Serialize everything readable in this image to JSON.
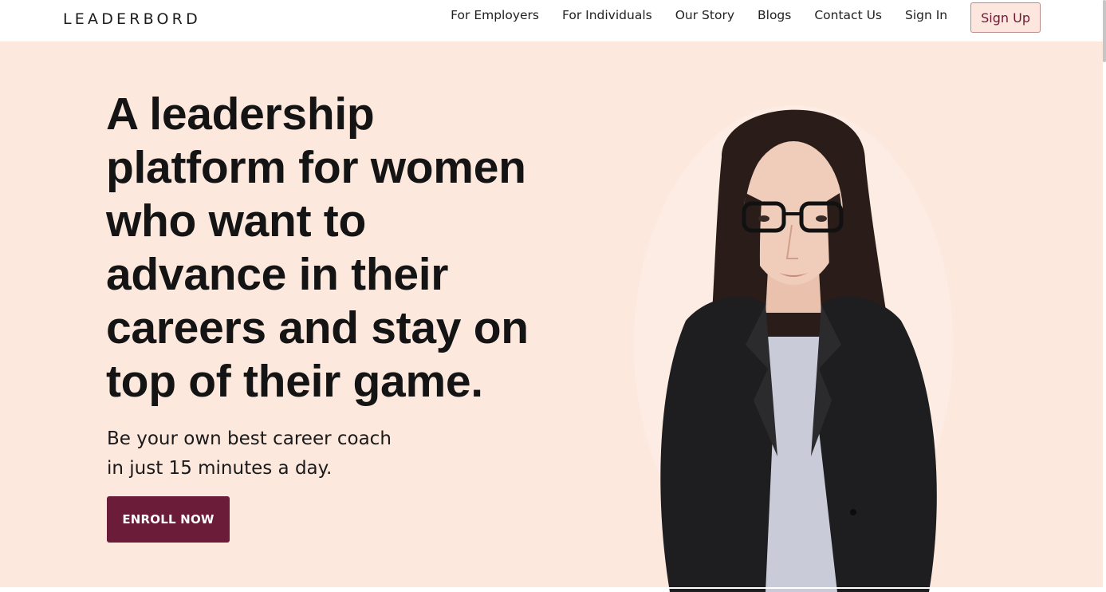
{
  "header": {
    "logo_text": "LEADERBORD",
    "nav": [
      {
        "label": "For Employers"
      },
      {
        "label": "For Individuals"
      },
      {
        "label": "Our Story"
      },
      {
        "label": "Blogs"
      },
      {
        "label": "Contact Us"
      },
      {
        "label": "Sign In"
      }
    ],
    "signup_label": "Sign Up"
  },
  "hero": {
    "headline": "A leadership platform for women who want to advance in their careers and stay on top of their game.",
    "subtext_line1": "Be your own best career coach",
    "subtext_line2": "in just 15 minutes a day.",
    "cta_label": "ENROLL NOW",
    "image_icon": "portrait-photo-woman-in-blazer"
  },
  "colors": {
    "hero_bg": "#fde8de",
    "brand_accent": "#6b1c38",
    "signup_bg": "#fce6dd",
    "text": "#141414"
  }
}
